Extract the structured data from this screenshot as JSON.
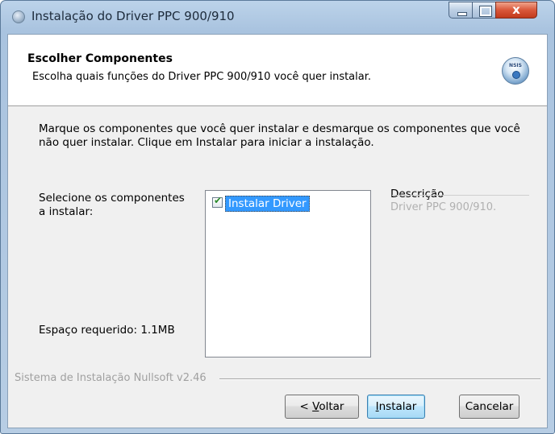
{
  "window": {
    "title": "Instalação do Driver PPC 900/910",
    "close_glyph": "x"
  },
  "header": {
    "title": "Escolher Componentes",
    "subtitle": "Escolha quais funções do Driver PPC 900/910 você quer instalar.",
    "logo_text": "NSIS"
  },
  "body": {
    "instructions": "Marque os componentes que você quer instalar e desmarque os componentes que você não quer instalar. Clique em Instalar para iniciar a instalação.",
    "select_label": "Selecione os componentes a instalar:",
    "space_label": "Espaço requerido: 1.1MB",
    "components": [
      {
        "label": "Instalar Driver",
        "checked": true,
        "selected": true
      }
    ],
    "description_title": "Descrição",
    "description_text": "Driver PPC 900/910."
  },
  "footer": {
    "branding": "Sistema de Instalação Nullsoft v2.46",
    "back_button": "< Voltar",
    "back_button_accel": "V",
    "install_button": "Instalar",
    "install_button_accel": "I",
    "cancel_button": "Cancelar"
  },
  "icons": {
    "title_icon": "installer-icon",
    "logo": "nsis-logo-icon",
    "check": "checkmark-icon"
  },
  "colors": {
    "selection": "#3399ff",
    "default_button_border": "#3c7fb1",
    "close_button": "#c13a1c"
  }
}
